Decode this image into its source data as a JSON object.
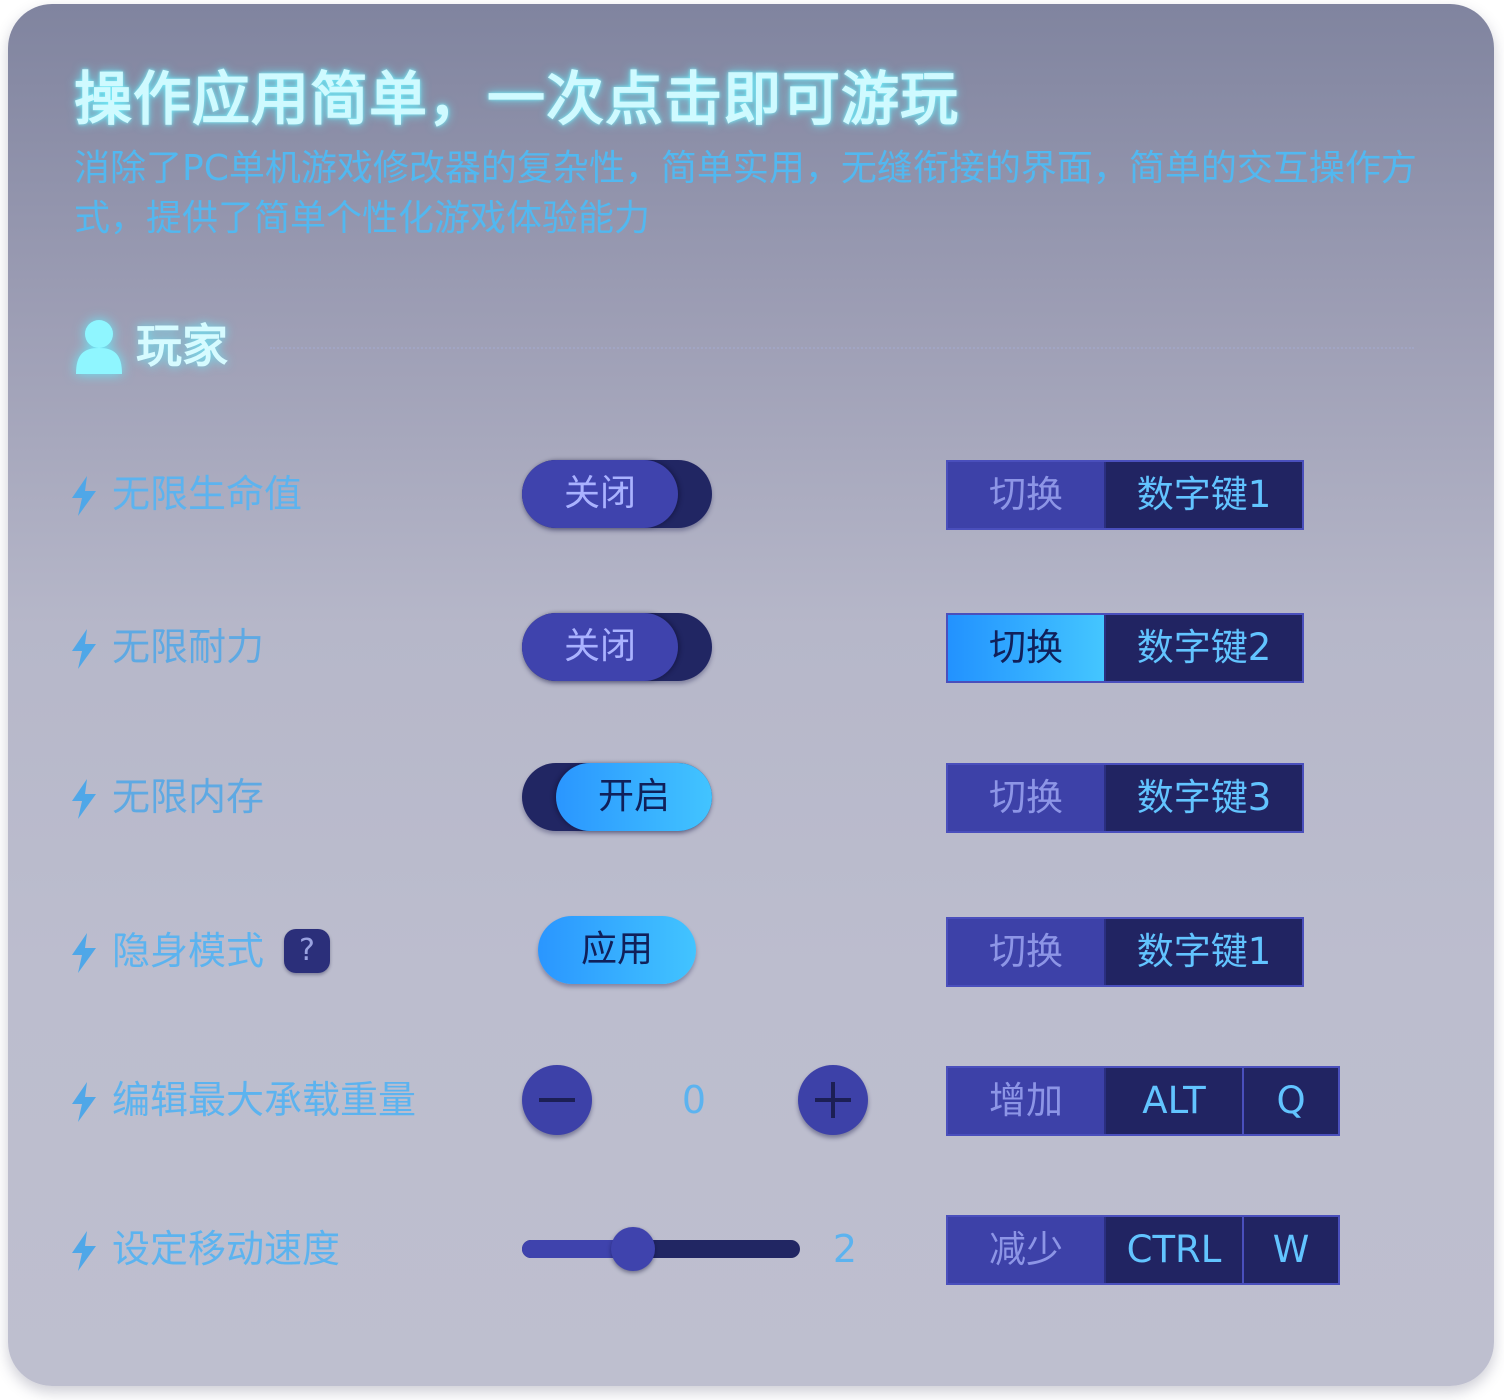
{
  "header": {
    "title": "操作应用简单，一次点击即可游玩",
    "subtitle": "消除了PC单机游戏修改器的复杂性，简单实用，无缝衔接的界面，简单的交互操作方式，提供了简单个性化游戏体验能力"
  },
  "section": {
    "title": "玩家",
    "icon": "person-icon"
  },
  "rows": [
    {
      "label": "无限生命值",
      "control": {
        "type": "toggle",
        "label": "关闭",
        "on": false
      },
      "keys": {
        "action": "切换",
        "keys": [
          "数字键1"
        ]
      }
    },
    {
      "label": "无限耐力",
      "control": {
        "type": "toggle",
        "label": "关闭",
        "on": false
      },
      "keys": {
        "action": "切换",
        "keys": [
          "数字键2"
        ],
        "highlighted": true
      }
    },
    {
      "label": "无限内存",
      "control": {
        "type": "toggle",
        "label": "开启",
        "on": true
      },
      "keys": {
        "action": "切换",
        "keys": [
          "数字键3"
        ]
      }
    },
    {
      "label": "隐身模式",
      "help": "?",
      "control": {
        "type": "button",
        "label": "应用"
      },
      "keys": {
        "action": "切换",
        "keys": [
          "数字键1"
        ]
      }
    },
    {
      "label": "编辑最大承载重量",
      "control": {
        "type": "stepper",
        "value": "0"
      },
      "keys": {
        "action": "增加",
        "keys": [
          "ALT",
          "Q"
        ]
      }
    },
    {
      "label": "设定移动速度",
      "control": {
        "type": "slider",
        "value": "2",
        "fraction": 0.4
      },
      "keys": {
        "action": "减少",
        "keys": [
          "CTRL",
          "W"
        ]
      }
    }
  ],
  "colors": {
    "accent": "#42c4ff",
    "dark": "#212462",
    "knob": "#3f43ad",
    "label": "#5cb3ef"
  }
}
